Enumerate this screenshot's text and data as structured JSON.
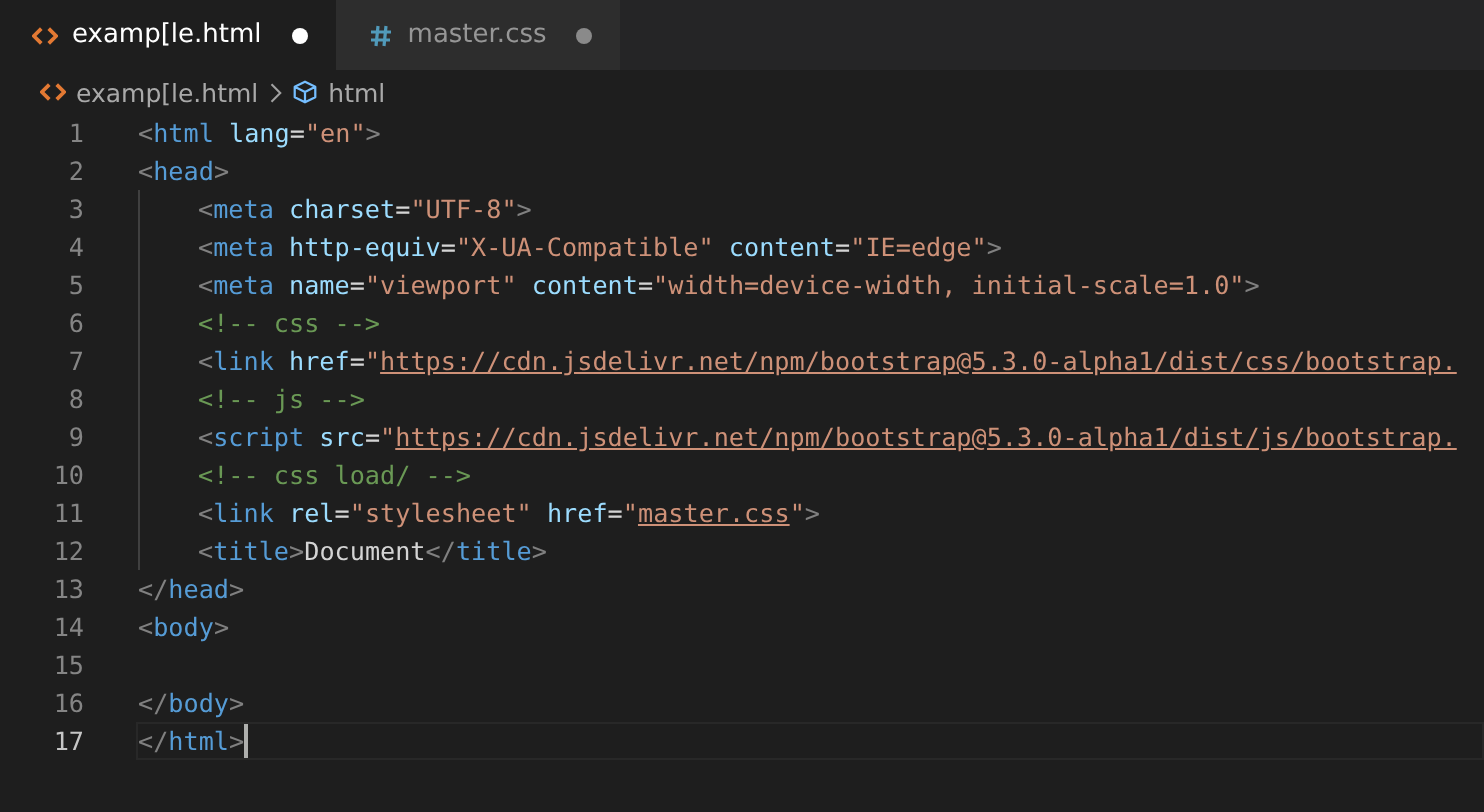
{
  "tabs": [
    {
      "label": "examp[le.html",
      "kind": "html",
      "selected": true,
      "modified": true
    },
    {
      "label": "master.css",
      "kind": "css",
      "selected": false,
      "modified": true
    }
  ],
  "breadcrumbs": [
    {
      "label": "examp[le.html",
      "kind": "file"
    },
    {
      "label": "html",
      "kind": "symbol"
    }
  ],
  "lines": [
    {
      "number": "1",
      "current": false,
      "indented": false,
      "tokens": [
        {
          "kind": "punct",
          "text": "<"
        },
        {
          "kind": "tag",
          "text": "html"
        },
        {
          "kind": "attr",
          "text": " lang"
        },
        {
          "kind": "text",
          "text": "="
        },
        {
          "kind": "str",
          "text": "\"en\""
        },
        {
          "kind": "punct",
          "text": ">"
        }
      ]
    },
    {
      "number": "2",
      "current": false,
      "indented": false,
      "tokens": [
        {
          "kind": "punct",
          "text": "<"
        },
        {
          "kind": "tag",
          "text": "head"
        },
        {
          "kind": "punct",
          "text": ">"
        }
      ]
    },
    {
      "number": "3",
      "current": false,
      "indented": true,
      "tokens": [
        {
          "kind": "punct",
          "text": "<"
        },
        {
          "kind": "tag",
          "text": "meta"
        },
        {
          "kind": "attr",
          "text": " charset"
        },
        {
          "kind": "text",
          "text": "="
        },
        {
          "kind": "str",
          "text": "\"UTF-8\""
        },
        {
          "kind": "punct",
          "text": ">"
        }
      ]
    },
    {
      "number": "4",
      "current": false,
      "indented": true,
      "tokens": [
        {
          "kind": "punct",
          "text": "<"
        },
        {
          "kind": "tag",
          "text": "meta"
        },
        {
          "kind": "attr",
          "text": " http-equiv"
        },
        {
          "kind": "text",
          "text": "="
        },
        {
          "kind": "str",
          "text": "\"X-UA-Compatible\""
        },
        {
          "kind": "attr",
          "text": " content"
        },
        {
          "kind": "text",
          "text": "="
        },
        {
          "kind": "str",
          "text": "\"IE=edge\""
        },
        {
          "kind": "punct",
          "text": ">"
        }
      ]
    },
    {
      "number": "5",
      "current": false,
      "indented": true,
      "tokens": [
        {
          "kind": "punct",
          "text": "<"
        },
        {
          "kind": "tag",
          "text": "meta"
        },
        {
          "kind": "attr",
          "text": " name"
        },
        {
          "kind": "text",
          "text": "="
        },
        {
          "kind": "str",
          "text": "\"viewport\""
        },
        {
          "kind": "attr",
          "text": " content"
        },
        {
          "kind": "text",
          "text": "="
        },
        {
          "kind": "str",
          "text": "\"width=device-width, initial-scale=1.0\""
        },
        {
          "kind": "punct",
          "text": ">"
        }
      ]
    },
    {
      "number": "6",
      "current": false,
      "indented": true,
      "tokens": [
        {
          "kind": "comment",
          "text": "<!-- css -->"
        }
      ]
    },
    {
      "number": "7",
      "current": false,
      "indented": true,
      "tokens": [
        {
          "kind": "punct",
          "text": "<"
        },
        {
          "kind": "tag",
          "text": "link"
        },
        {
          "kind": "attr",
          "text": " href"
        },
        {
          "kind": "text",
          "text": "="
        },
        {
          "kind": "str",
          "text": "\""
        },
        {
          "kind": "link",
          "text": "https://cdn.jsdelivr.net/npm/bootstrap@5.3.0-alpha1/dist/css/bootstrap."
        }
      ]
    },
    {
      "number": "8",
      "current": false,
      "indented": true,
      "tokens": [
        {
          "kind": "comment",
          "text": "<!-- js -->"
        }
      ]
    },
    {
      "number": "9",
      "current": false,
      "indented": true,
      "tokens": [
        {
          "kind": "punct",
          "text": "<"
        },
        {
          "kind": "tag",
          "text": "script"
        },
        {
          "kind": "attr",
          "text": " src"
        },
        {
          "kind": "text",
          "text": "="
        },
        {
          "kind": "str",
          "text": "\""
        },
        {
          "kind": "link",
          "text": "https://cdn.jsdelivr.net/npm/bootstrap@5.3.0-alpha1/dist/js/bootstrap."
        }
      ]
    },
    {
      "number": "10",
      "current": false,
      "indented": true,
      "tokens": [
        {
          "kind": "comment",
          "text": "<!-- css load/ -->"
        }
      ]
    },
    {
      "number": "11",
      "current": false,
      "indented": true,
      "tokens": [
        {
          "kind": "punct",
          "text": "<"
        },
        {
          "kind": "tag",
          "text": "link"
        },
        {
          "kind": "attr",
          "text": " rel"
        },
        {
          "kind": "text",
          "text": "="
        },
        {
          "kind": "str",
          "text": "\"stylesheet\""
        },
        {
          "kind": "attr",
          "text": " href"
        },
        {
          "kind": "text",
          "text": "="
        },
        {
          "kind": "str",
          "text": "\""
        },
        {
          "kind": "link",
          "text": "master.css"
        },
        {
          "kind": "str",
          "text": "\""
        },
        {
          "kind": "punct",
          "text": ">"
        }
      ]
    },
    {
      "number": "12",
      "current": false,
      "indented": true,
      "tokens": [
        {
          "kind": "punct",
          "text": "<"
        },
        {
          "kind": "tag",
          "text": "title"
        },
        {
          "kind": "punct",
          "text": ">"
        },
        {
          "kind": "text",
          "text": "Document"
        },
        {
          "kind": "punct",
          "text": "</"
        },
        {
          "kind": "tag",
          "text": "title"
        },
        {
          "kind": "punct",
          "text": ">"
        }
      ]
    },
    {
      "number": "13",
      "current": false,
      "indented": false,
      "tokens": [
        {
          "kind": "punct",
          "text": "</"
        },
        {
          "kind": "tag",
          "text": "head"
        },
        {
          "kind": "punct",
          "text": ">"
        }
      ]
    },
    {
      "number": "14",
      "current": false,
      "indented": false,
      "tokens": [
        {
          "kind": "punct",
          "text": "<"
        },
        {
          "kind": "tag",
          "text": "body"
        },
        {
          "kind": "punct",
          "text": ">"
        }
      ]
    },
    {
      "number": "15",
      "current": false,
      "indented": false
    },
    {
      "number": "16",
      "current": false,
      "indented": false,
      "tokens": [
        {
          "kind": "punct",
          "text": "</"
        },
        {
          "kind": "tag",
          "text": "body"
        },
        {
          "kind": "punct",
          "text": ">"
        }
      ]
    },
    {
      "number": "17",
      "current": true,
      "indented": false,
      "tokens": [
        {
          "kind": "punct",
          "text": "</"
        },
        {
          "kind": "tag",
          "text": "html"
        },
        {
          "kind": "punct",
          "text": ">"
        }
      ]
    }
  ]
}
